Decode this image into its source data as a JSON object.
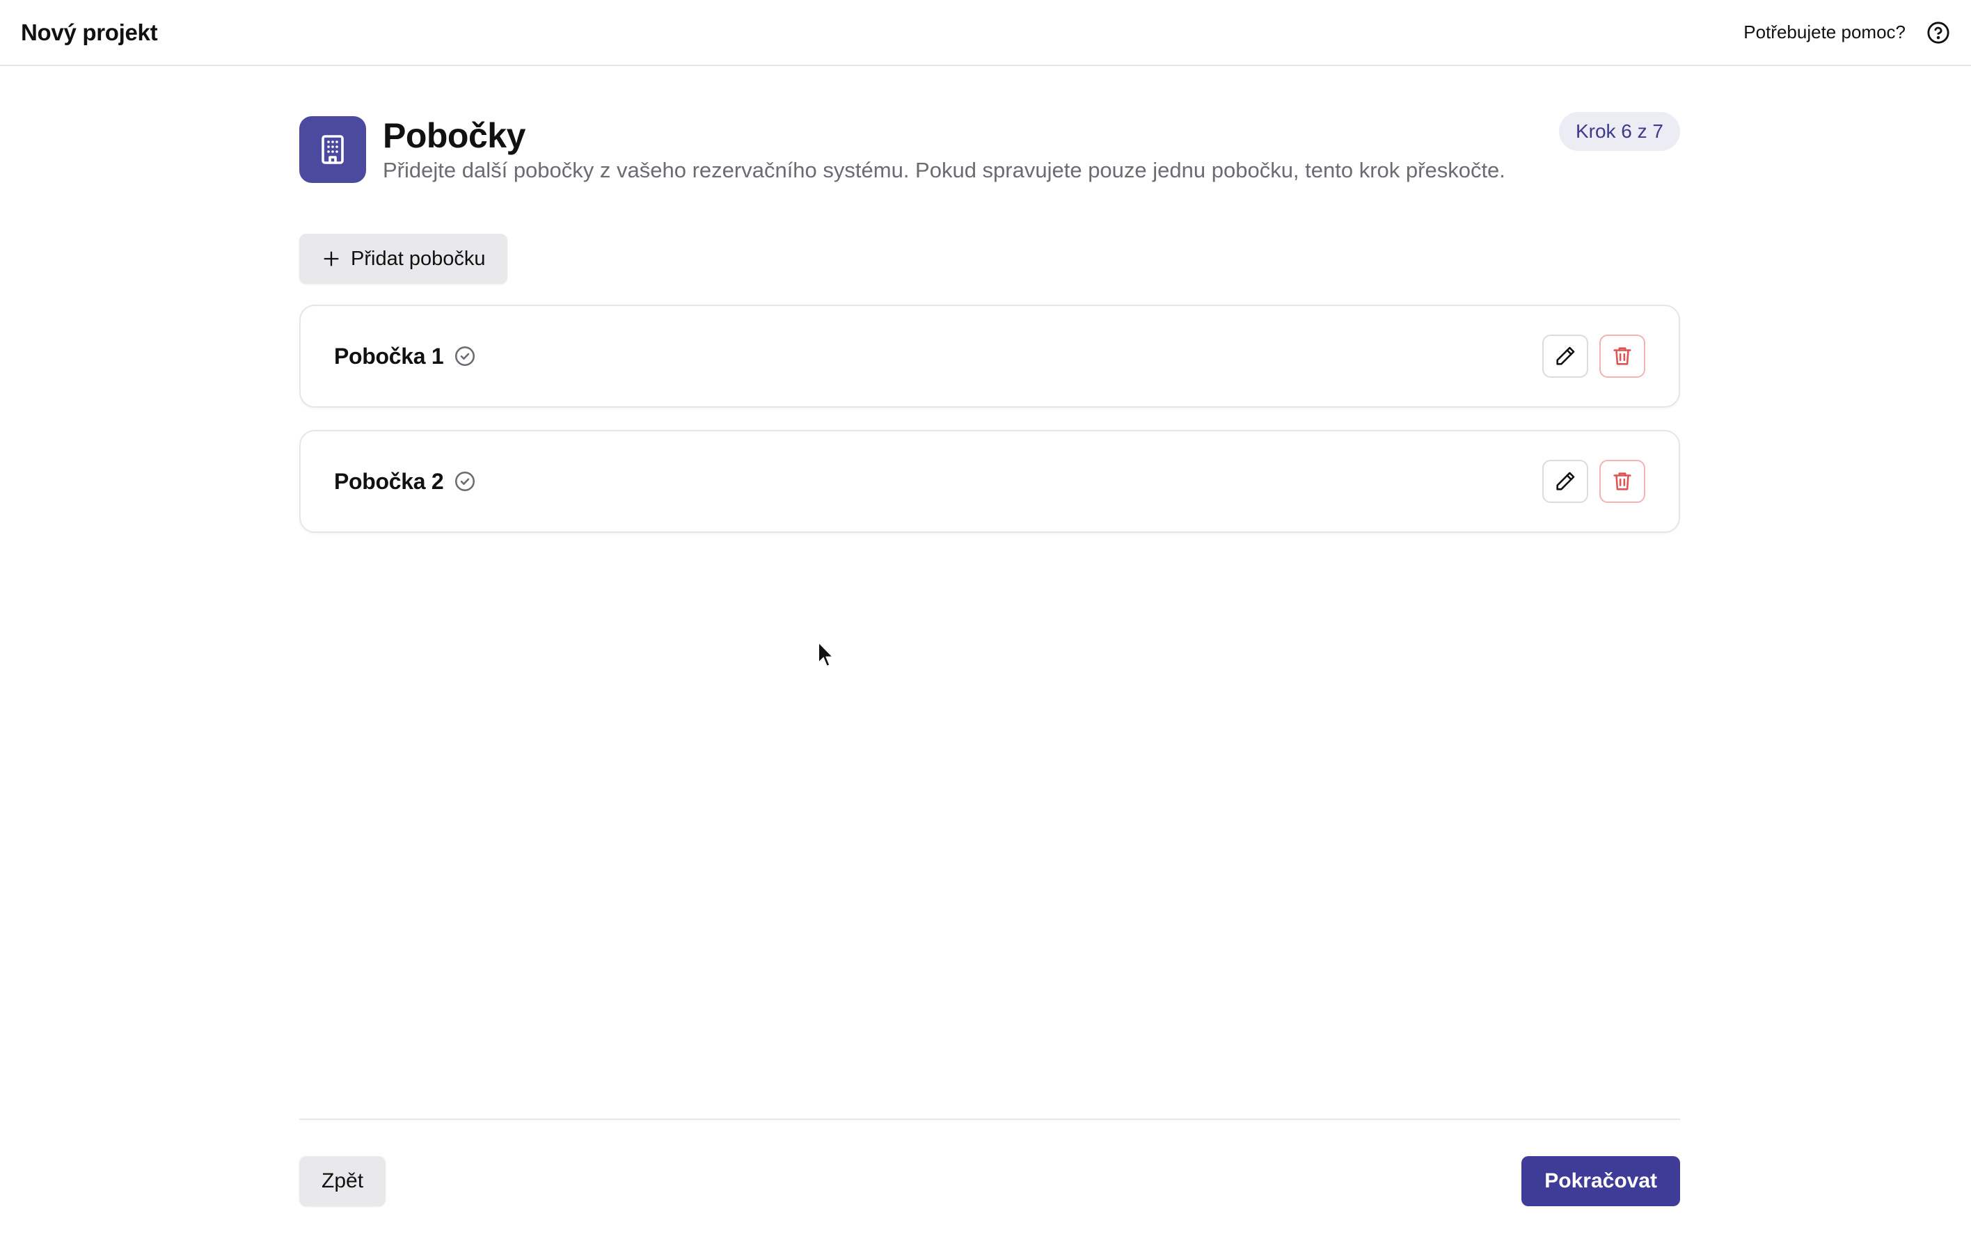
{
  "app": {
    "title": "Nový projekt",
    "help_label": "Potřebujete pomoc?",
    "help_icon": "help-circle-icon"
  },
  "header": {
    "icon": "building-icon",
    "title": "Pobočky",
    "subtitle": "Přidejte další pobočky z vašeho rezervačního systému. Pokud spravujete pouze jednu pobočku, tento krok přeskočte.",
    "step_badge": "Krok 6 z 7"
  },
  "actions": {
    "add_branch_label": "Přidat pobočku",
    "add_icon": "plus-icon"
  },
  "branches": [
    {
      "name": "Pobočka 1",
      "status_icon": "check-circle-icon",
      "edit_icon": "pencil-icon",
      "delete_icon": "trash-icon"
    },
    {
      "name": "Pobočka 2",
      "status_icon": "check-circle-icon",
      "edit_icon": "pencil-icon",
      "delete_icon": "trash-icon"
    }
  ],
  "footer": {
    "back_label": "Zpět",
    "next_label": "Pokračovat"
  },
  "colors": {
    "accent": "#3f3c98",
    "icon_tile": "#4c4a9e",
    "badge_bg": "#ececf4",
    "danger": "#e05252",
    "muted_text": "#6b6b72"
  }
}
